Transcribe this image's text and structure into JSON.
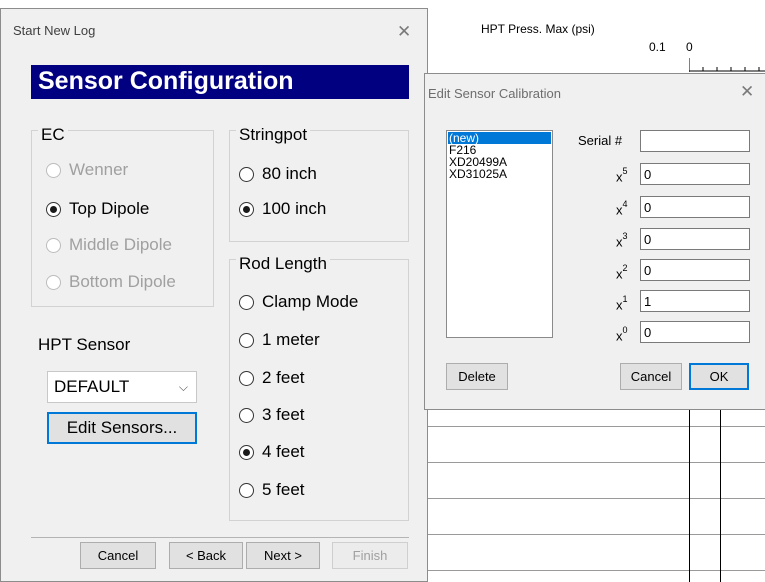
{
  "plot": {
    "title": "HPT Press. Max (psi)",
    "tick_labels": [
      "0.1",
      "0"
    ]
  },
  "wizard": {
    "title": "Start New Log",
    "banner": "Sensor Configuration",
    "ec": {
      "title": "EC",
      "options": [
        {
          "label": "Wenner",
          "checked": false,
          "enabled": false
        },
        {
          "label": "Top Dipole",
          "checked": true,
          "enabled": true
        },
        {
          "label": "Middle Dipole",
          "checked": false,
          "enabled": false
        },
        {
          "label": "Bottom Dipole",
          "checked": false,
          "enabled": false
        }
      ]
    },
    "stringpot": {
      "title": "Stringpot",
      "options": [
        {
          "label": "80 inch",
          "checked": false
        },
        {
          "label": "100 inch",
          "checked": true
        }
      ]
    },
    "rod_length": {
      "title": "Rod Length",
      "options": [
        {
          "label": "Clamp Mode",
          "checked": false
        },
        {
          "label": "1 meter",
          "checked": false
        },
        {
          "label": "2 feet",
          "checked": false
        },
        {
          "label": "3 feet",
          "checked": false
        },
        {
          "label": "4 feet",
          "checked": true
        },
        {
          "label": "5 feet",
          "checked": false
        }
      ]
    },
    "hpt_sensor": {
      "label": "HPT Sensor",
      "selected": "DEFAULT",
      "edit_button": "Edit Sensors..."
    },
    "footer": {
      "cancel": "Cancel",
      "back": "< Back",
      "next": "Next >",
      "finish": "Finish"
    }
  },
  "calibration": {
    "title": "Edit Sensor Calibration",
    "sensors": [
      "(new)",
      "F216",
      "XD20499A",
      "XD31025A"
    ],
    "selected_index": 0,
    "serial_label": "Serial #",
    "serial_value": "",
    "coefficients": [
      {
        "base": "x",
        "power": "5",
        "value": "0"
      },
      {
        "base": "x",
        "power": "4",
        "value": "0"
      },
      {
        "base": "x",
        "power": "3",
        "value": "0"
      },
      {
        "base": "x",
        "power": "2",
        "value": "0"
      },
      {
        "base": "x",
        "power": "1",
        "value": "1"
      },
      {
        "base": "x",
        "power": "0",
        "value": "0"
      }
    ],
    "delete": "Delete",
    "cancel": "Cancel",
    "ok": "OK"
  }
}
